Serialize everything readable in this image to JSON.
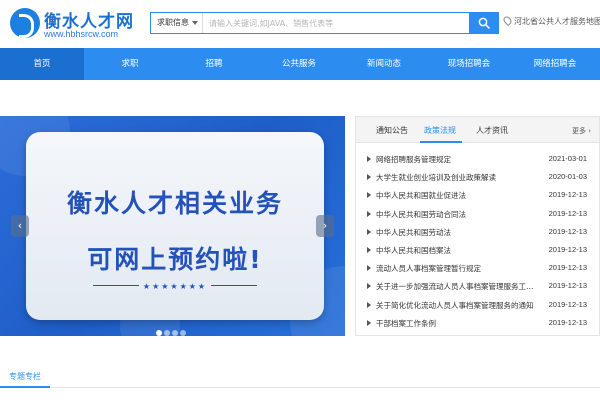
{
  "header": {
    "logo_title": "衡水人才网",
    "logo_url": "www.hbhsrcw.com",
    "search_category": "求职信息",
    "search_placeholder": "请输入关键词,如JAVA、销售代表等",
    "location": "河北省公共人才服务地图"
  },
  "nav": {
    "items": [
      "首页",
      "求职",
      "招聘",
      "公共服务",
      "新闻动态",
      "现场招聘会",
      "网络招聘会"
    ],
    "active_index": 0
  },
  "banner": {
    "line1": "衡水人才相关业务",
    "line2": "可网上预约啦!",
    "stars": "★★★★★★★",
    "prev": "‹",
    "next": "›",
    "slide_count": 4,
    "active_slide": 0
  },
  "news": {
    "tabs": [
      "通知公告",
      "政策法规",
      "人才资讯"
    ],
    "active_tab": 1,
    "more": "更多 ›",
    "items": [
      {
        "title": "网络招聘服务管理规定",
        "date": "2021-03-01"
      },
      {
        "title": "大学生就业创业培训及创业政策解读",
        "date": "2020-01-03"
      },
      {
        "title": "中华人民共和国就业促进法",
        "date": "2019-12-13"
      },
      {
        "title": "中华人民共和国劳动合同法",
        "date": "2019-12-13"
      },
      {
        "title": "中华人民共和国劳动法",
        "date": "2019-12-13"
      },
      {
        "title": "中华人民共和国档案法",
        "date": "2019-12-13"
      },
      {
        "title": "流动人员人事档案管理暂行规定",
        "date": "2019-12-13"
      },
      {
        "title": "关于进一步加强流动人员人事档案管理服务工作...",
        "date": "2019-12-13"
      },
      {
        "title": "关于简化优化流动人员人事档案管理服务的通知",
        "date": "2019-12-13"
      },
      {
        "title": "干部档案工作条例",
        "date": "2019-12-13"
      }
    ]
  },
  "section": {
    "tab": "专题专栏"
  },
  "colors": {
    "primary": "#2d8cf0",
    "nav_active": "#1a6fd1",
    "banner_bg": "#2b6dd9",
    "banner_text": "#2452b8"
  },
  "icons": {
    "search": "search-icon",
    "location": "location-pin-icon",
    "arrow_left": "chevron-left-icon",
    "arrow_right": "chevron-right-icon"
  }
}
